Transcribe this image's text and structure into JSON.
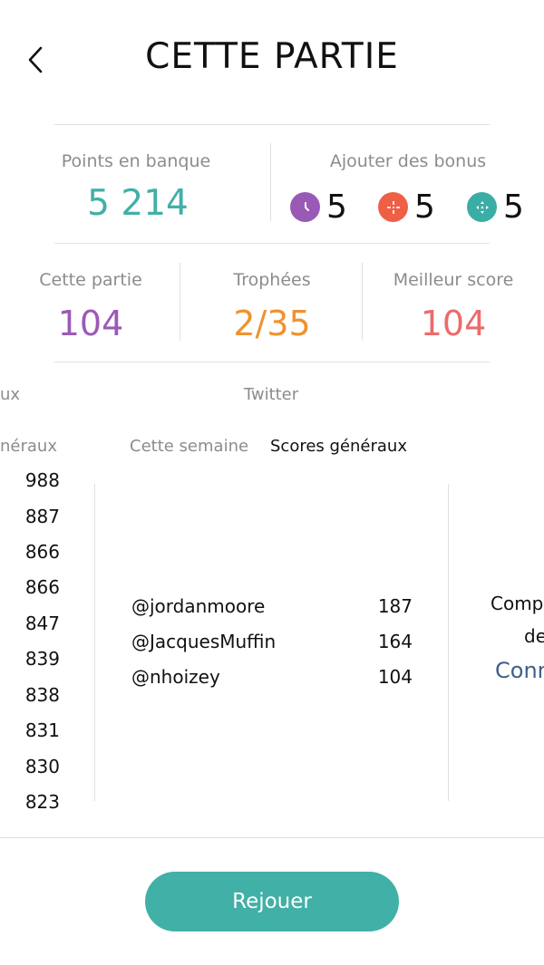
{
  "header": {
    "title": "CETTE PARTIE"
  },
  "bank": {
    "label": "Points en banque",
    "value": "5 214"
  },
  "bonus": {
    "label": "Ajouter des bonus",
    "items": [
      {
        "icon": "clock-icon",
        "color": "#9b59b6",
        "count": "5"
      },
      {
        "icon": "target-icon",
        "color": "#ee5f45",
        "count": "5"
      },
      {
        "icon": "move-arrows-icon",
        "color": "#3aaea6",
        "count": "5"
      }
    ]
  },
  "stats": [
    {
      "label": "Cette partie",
      "value": "104",
      "color": "#9d59b6"
    },
    {
      "label": "Trophées",
      "value": "2/35",
      "color": "#f0922e"
    },
    {
      "label": "Meilleur score",
      "value": "104",
      "color": "#ec6b6b"
    }
  ],
  "left_panel": {
    "header_partial": "ux",
    "tab_partial": "néraux",
    "scores": [
      "988",
      "887",
      "866",
      "866",
      "847",
      "839",
      "838",
      "831",
      "830",
      "823"
    ]
  },
  "twitter_panel": {
    "header": "Twitter",
    "tabs": [
      "Cette semaine",
      "Scores généraux"
    ],
    "rows": [
      {
        "user": "@jordanmoore",
        "score": "187"
      },
      {
        "user": "@JacquesMuffin",
        "score": "164"
      },
      {
        "user": "@nhoizey",
        "score": "104"
      }
    ]
  },
  "right_panel": {
    "line1_partial": "Comp",
    "line2_partial": "de",
    "link_partial": "Conn"
  },
  "footer": {
    "replay_label": "Rejouer"
  },
  "colors": {
    "accent": "#41b0a6",
    "link": "#3f5f8a"
  }
}
